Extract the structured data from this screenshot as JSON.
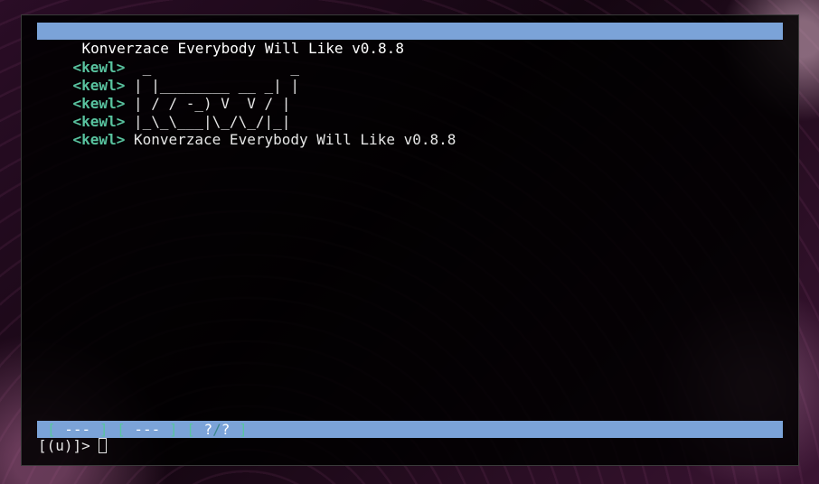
{
  "window": {
    "title": "Konverzace Everybody Will Like v0.8.8"
  },
  "messages": [
    {
      "prompt": "<kewl>",
      "text": " _                _"
    },
    {
      "prompt": "<kewl>",
      "text": "| |________ __ _| |"
    },
    {
      "prompt": "<kewl>",
      "text": "| / / -_) V  V / |"
    },
    {
      "prompt": "<kewl>",
      "text": "|_\\_\\___|\\_/\\_/|_|"
    },
    {
      "prompt": "<kewl>",
      "text": "Konverzace Everybody Will Like v0.8.8"
    }
  ],
  "status_bar": {
    "segment1_open": "[",
    "segment1_text": " --- ",
    "segment1_close": "]",
    "segment2_open": "[",
    "segment2_text": " --- ",
    "segment2_close": "]",
    "segment3_open": "[",
    "segment3_left": " ?",
    "segment3_sep": "/",
    "segment3_right": "? ",
    "segment3_close": "]"
  },
  "input": {
    "prompt": "[(u)]> ",
    "value": ""
  },
  "colors": {
    "bar_background": "#7ba3d8",
    "prompt_color": "#59c4a0",
    "text_color": "#e6e6e6"
  }
}
